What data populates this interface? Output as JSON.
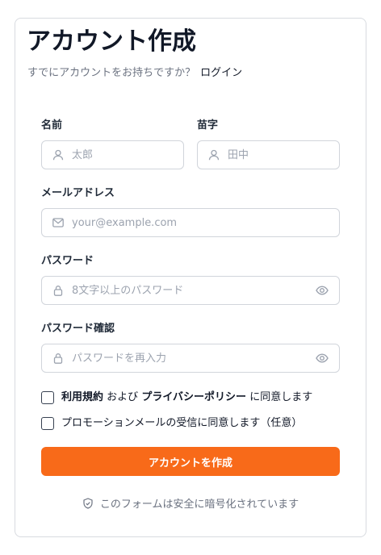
{
  "signup": {
    "title": "アカウント作成",
    "subtitle_text": "すでにアカウントをお持ちですか？",
    "login_link": "ログイン",
    "first_name": {
      "label": "名前",
      "placeholder": "太郎",
      "icon": "user-icon"
    },
    "last_name": {
      "label": "苗字",
      "placeholder": "田中",
      "icon": "user-icon"
    },
    "email": {
      "label": "メールアドレス",
      "placeholder": "your@example.com",
      "icon": "mail-icon"
    },
    "password": {
      "label": "パスワード",
      "placeholder": "8文字以上のパスワード",
      "icon": "lock-icon",
      "toggle_icon": "eye-icon"
    },
    "password_confirm": {
      "label": "パスワード確認",
      "placeholder": "パスワードを再入力",
      "icon": "lock-icon",
      "toggle_icon": "eye-icon"
    },
    "terms": {
      "checked": false,
      "terms_link": "利用規約",
      "and_text": "および",
      "privacy_link": "プライバシーポリシー",
      "agree_text": "に同意します"
    },
    "promo": {
      "checked": false,
      "label": "プロモーションメールの受信に同意します（任意）"
    },
    "submit_label": "アカウントを作成",
    "secure_note": "このフォームは安全に暗号化されています",
    "secure_icon": "shield-check-icon"
  },
  "colors": {
    "accent": "#f86a19",
    "border": "#d1d5db",
    "muted_text": "#6b7280",
    "placeholder": "#9ca3af",
    "text": "#111827"
  }
}
